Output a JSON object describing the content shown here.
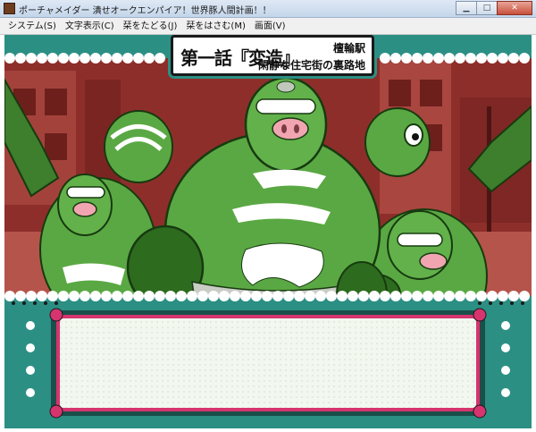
{
  "window": {
    "title": "ポーチャメイダー 潰せオークエンパイア！世界豚人間計画！！",
    "minimize_icon": "minimize-icon",
    "maximize_icon": "maximize-icon",
    "close_icon": "close-icon"
  },
  "menu": {
    "items": [
      {
        "label": "システム(S)"
      },
      {
        "label": "文字表示(C)"
      },
      {
        "label": "栞をたどる(J)"
      },
      {
        "label": "栞をはさむ(M)"
      },
      {
        "label": "画面(V)"
      }
    ]
  },
  "scene": {
    "episode_title": "第一話『変造』",
    "location": "檀輪駅",
    "sublocation": "閑静な住宅街の裏路地"
  },
  "message_window": {
    "text": ""
  },
  "colors": {
    "background_red": "#8a2b28",
    "character_green": "#4f9a3a",
    "frame_teal": "#2c8f84",
    "frame_pink": "#d6346e",
    "message_bg": "#f2f7ef"
  }
}
